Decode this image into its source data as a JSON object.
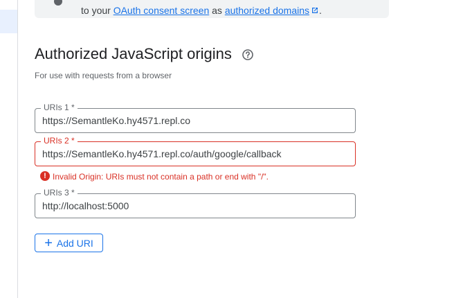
{
  "banner": {
    "text_prefix": "to your",
    "link1": "OAuth consent screen",
    "text_middle": "as",
    "link2": "authorized domains",
    "text_suffix": ".",
    "icon": "info-icon"
  },
  "section": {
    "title": "Authorized JavaScript origins",
    "help_icon": "help-circle-icon",
    "subtitle": "For use with requests from a browser"
  },
  "uris": [
    {
      "label": "URIs 1 *",
      "value": "https://SemantleKo.hy4571.repl.co",
      "error": false
    },
    {
      "label": "URIs 2 *",
      "value": "https://SemantleKo.hy4571.repl.co/auth/google/callback",
      "error": true
    },
    {
      "label": "URIs 3 *",
      "value": "http://localhost:5000",
      "error": false
    }
  ],
  "error_message": "Invalid Origin: URIs must not contain a path or end with \"/\".",
  "add_button": {
    "label": "Add URI",
    "icon": "plus-icon"
  },
  "colors": {
    "accent": "#1a73e8",
    "error": "#d93025",
    "border": "#80868b",
    "banner_bg": "#f1f3f4"
  }
}
